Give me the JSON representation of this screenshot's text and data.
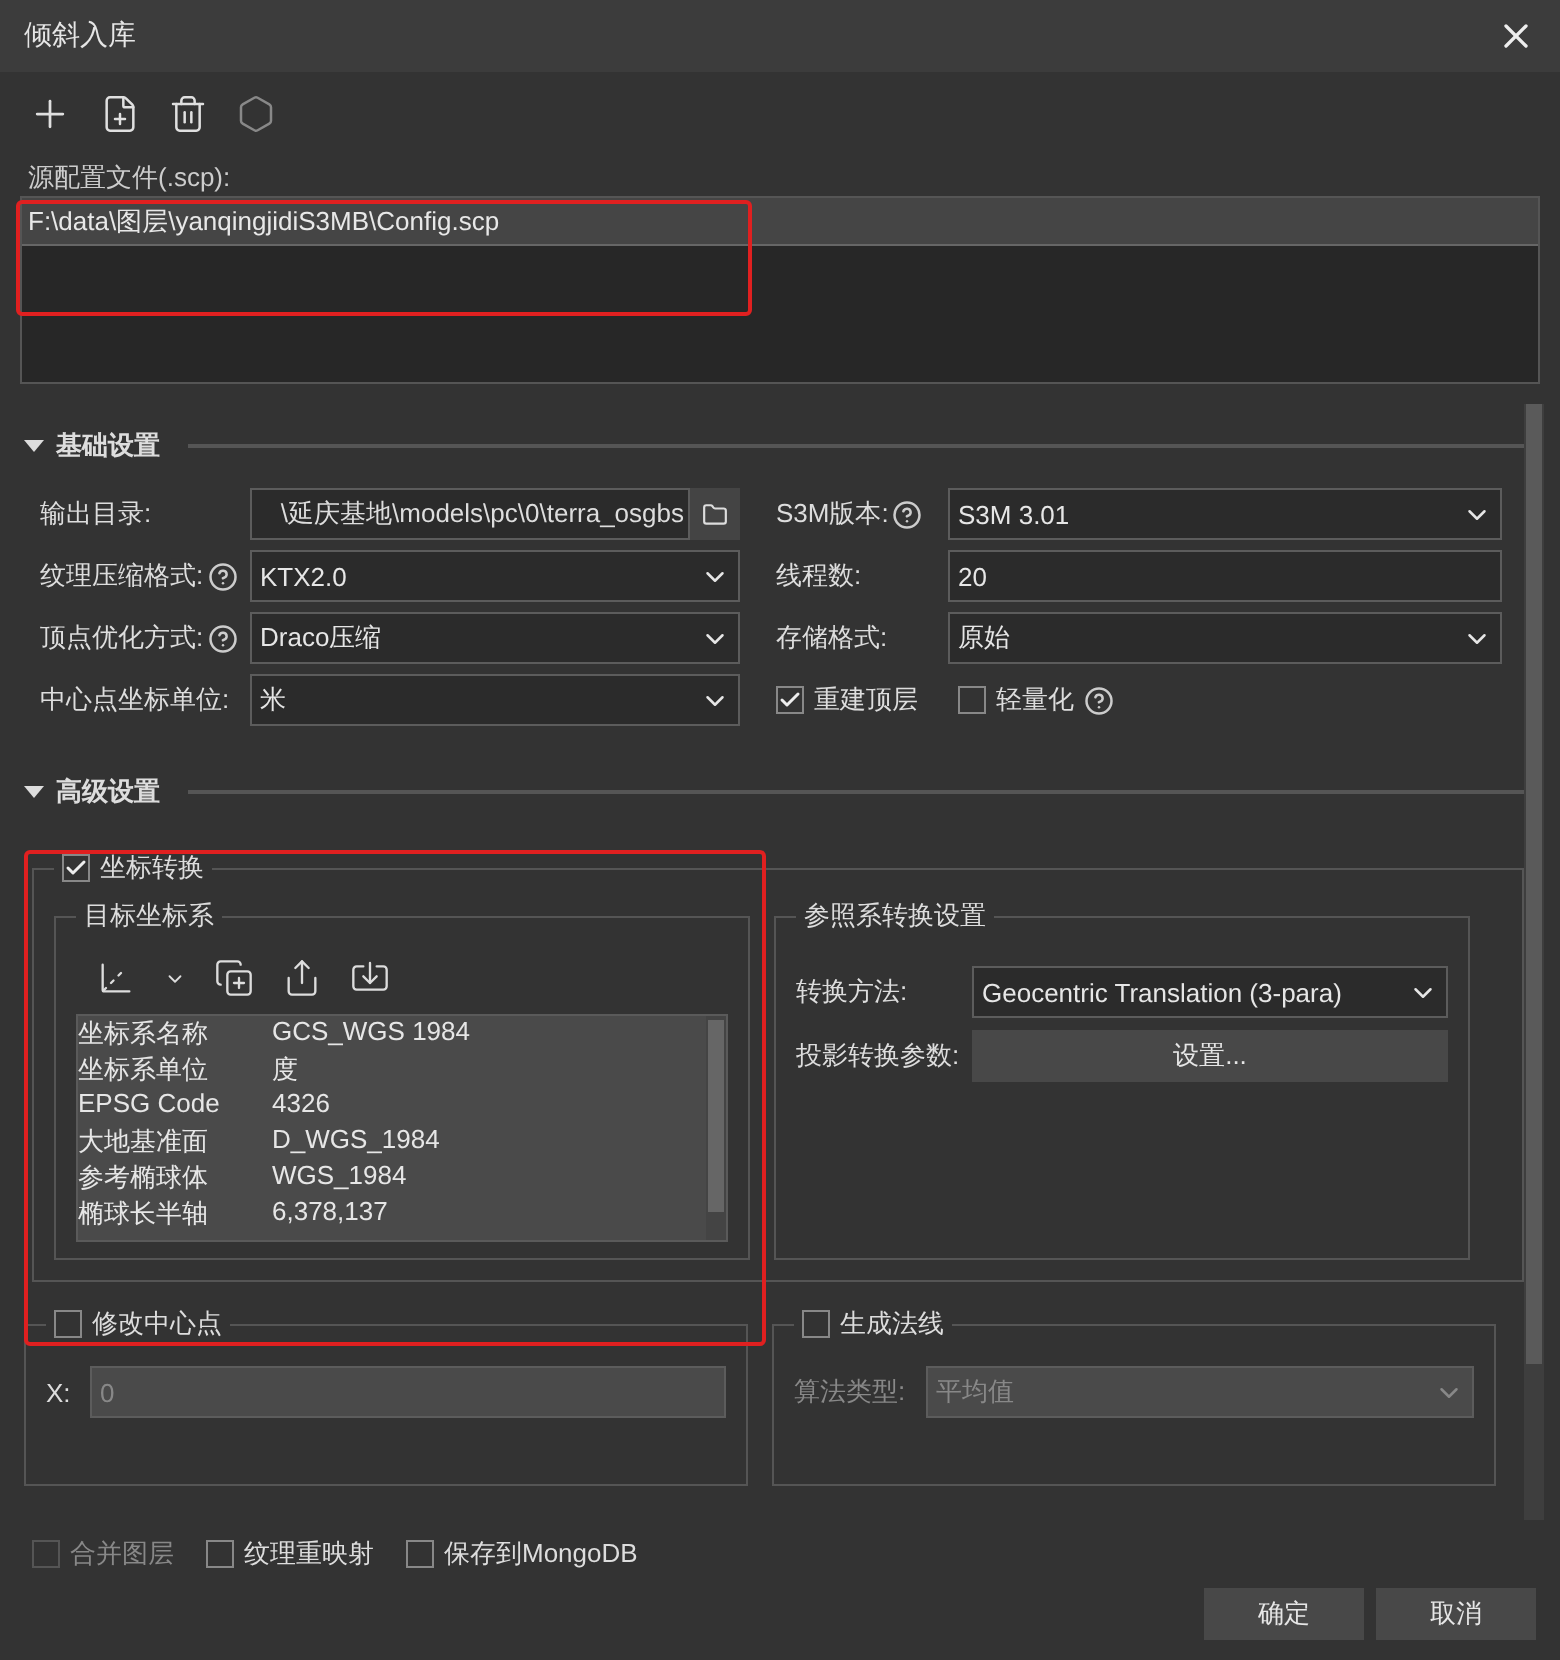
{
  "window": {
    "title": "倾斜入库"
  },
  "toolbar": [
    {
      "kind": "add",
      "disabled": false
    },
    {
      "kind": "add_file",
      "disabled": false
    },
    {
      "kind": "delete",
      "disabled": false
    },
    {
      "kind": "settings",
      "disabled": true
    }
  ],
  "source_files": {
    "label": "源配置文件(.scp):",
    "highlighted": true,
    "items": [
      {
        "path": "F:\\data\\图层\\yanqingjidiS3MB\\Config.scp",
        "selected": true
      }
    ]
  },
  "basic_settings": {
    "title": "基础设置",
    "expanded": true,
    "rows": [
      {
        "left": {
          "label": "输出目录:",
          "help": false,
          "kind": "path",
          "value": "\\延庆基地\\models\\pc\\0\\terra_osgbs"
        },
        "right": {
          "label": "S3M版本:",
          "help": true,
          "kind": "combo",
          "value": "S3M 3.01"
        }
      },
      {
        "left": {
          "label": "纹理压缩格式:",
          "help": true,
          "kind": "combo",
          "value": "KTX2.0"
        },
        "right": {
          "label": "线程数:",
          "help": false,
          "kind": "text",
          "value": "20"
        }
      },
      {
        "left": {
          "label": "顶点优化方式:",
          "help": true,
          "kind": "combo",
          "value": "Draco压缩"
        },
        "right": {
          "label": "存储格式:",
          "help": false,
          "kind": "combo",
          "value": "原始"
        }
      },
      {
        "left": {
          "label": "中心点坐标单位:",
          "help": false,
          "kind": "combo",
          "value": "米"
        },
        "right": {
          "kind": "checks",
          "items": [
            {
              "label": "重建顶层",
              "checked": true,
              "help": false
            },
            {
              "label": "轻量化",
              "checked": false,
              "help": true
            }
          ]
        }
      }
    ]
  },
  "advanced_settings": {
    "title": "高级设置",
    "expanded": true,
    "coordinate_transform": {
      "label": "坐标转换",
      "checked": true,
      "highlighted": true,
      "target": {
        "title": "目标坐标系",
        "properties": [
          {
            "name": "坐标系名称",
            "value": "GCS_WGS 1984"
          },
          {
            "name": "坐标系单位",
            "value": "度"
          },
          {
            "name": "EPSG Code",
            "value": "4326"
          },
          {
            "name": "大地基准面",
            "value": "D_WGS_1984"
          },
          {
            "name": "参考椭球体",
            "value": "WGS_1984"
          },
          {
            "name": "椭球长半轴",
            "value": "6,378,137"
          }
        ]
      },
      "reference": {
        "title": "参照系转换设置",
        "method_label": "转换方法:",
        "method": "Geocentric Translation (3-para)",
        "params_label": "投影转换参数:",
        "params_button": "设置..."
      }
    },
    "center_point": {
      "label": "修改中心点",
      "checked": false,
      "x_label": "X:",
      "x_value": "0",
      "disabled": true
    },
    "normals": {
      "label": "生成法线",
      "checked": false,
      "algorithm_label": "算法类型:",
      "algorithm": "平均值",
      "disabled": true
    }
  },
  "options": [
    {
      "label": "合并图层",
      "checked": false,
      "disabled": true
    },
    {
      "label": "纹理重映射",
      "checked": false,
      "disabled": false
    },
    {
      "label": "保存到MongoDB",
      "checked": false,
      "disabled": false
    }
  ],
  "buttons": [
    "确定",
    "取消"
  ]
}
